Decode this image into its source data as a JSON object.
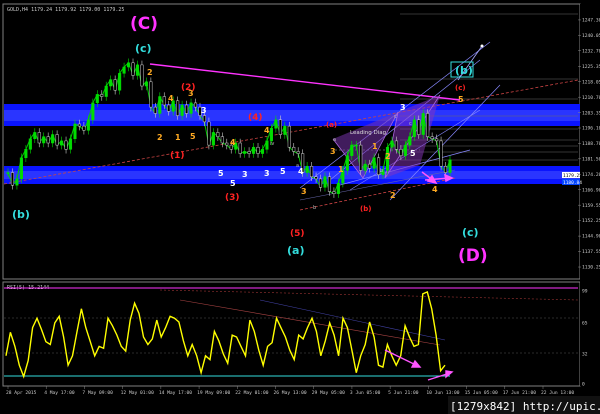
{
  "window": {
    "main_title": "GOLD,H4  1179.24 1179.92 1179.00 1179.25",
    "indicator_title": "RSI(5) 15.2144",
    "watermark": "[1279x842] http://upic.me/"
  },
  "colors": {
    "background": "#000000",
    "candle_up": "#00dd00",
    "zone_blue": "#0000ff",
    "rsi_line": "#ffff00",
    "magenta": "#ff33ff",
    "cyan_label": "#33dddd",
    "orange_label": "#ffaa22",
    "red_label": "#ff2222"
  },
  "chart_data": [
    {
      "type": "line",
      "name": "price",
      "x": [
        "28 Apr 2015",
        "4 May 17:00",
        "7 May 09:00",
        "12 May 01:00",
        "14 May 17:00",
        "19 May 09:00",
        "22 May 01:00",
        "26 May 13:00",
        "29 May 05:00",
        "3 Jun 05:00",
        "5 Jun 21:00",
        "10 Jun 13:00",
        "15 Jun 05:00",
        "17 Jun 21:00",
        "22 Jun 13:00"
      ],
      "y_ticks": [
        "1247.30",
        "1240.05",
        "1232.70",
        "1225.35",
        "1218.05",
        "1210.70",
        "1203.35",
        "1196.10",
        "1188.70",
        "1181.50",
        "1174.20",
        "1166.90",
        "1159.55",
        "1152.25",
        "1144.90",
        "1137.55",
        "1130.25"
      ],
      "ylim": [
        1126,
        1252
      ],
      "series": [
        {
          "values": [
            1175,
            1169,
            1172,
            1182,
            1186,
            1191,
            1194,
            1189,
            1192,
            1189,
            1193,
            1188,
            1190,
            1186,
            1191,
            1198,
            1197,
            1195,
            1200,
            1208,
            1212,
            1211,
            1216,
            1219,
            1214,
            1222,
            1225,
            1227,
            1221,
            1226,
            1216,
            1218,
            1206,
            1203,
            1211,
            1207,
            1204,
            1209,
            1202,
            1207,
            1203,
            1208,
            1206,
            1202,
            1199,
            1188,
            1194,
            1192,
            1189,
            1188,
            1186,
            1189,
            1184,
            1185,
            1184,
            1187,
            1184,
            1186,
            1190,
            1196,
            1200,
            1193,
            1197,
            1187,
            1185,
            1184,
            1175,
            1178,
            1173,
            1172,
            1168,
            1173,
            1166,
            1165,
            1170,
            1176,
            1183,
            1188,
            1188,
            1176,
            1179,
            1177,
            1182,
            1174,
            1176,
            1187,
            1190,
            1186,
            1183,
            1188,
            1192,
            1200,
            1193,
            1203,
            1192,
            1191,
            1190,
            1178,
            1175,
            1181
          ]
        }
      ],
      "price_box_values": [
        "1179.25",
        "1180.84"
      ]
    },
    {
      "type": "line",
      "name": "rsi",
      "y_ticks": [
        "99",
        "65",
        "32",
        "0"
      ],
      "ylim": [
        0,
        100
      ],
      "series": [
        {
          "values": [
            30,
            55,
            40,
            20,
            8,
            25,
            60,
            70,
            58,
            45,
            42,
            65,
            72,
            50,
            20,
            30,
            55,
            80,
            60,
            45,
            30,
            40,
            38,
            70,
            62,
            52,
            40,
            35,
            68,
            86,
            75,
            50,
            42,
            48,
            68,
            50,
            60,
            72,
            70,
            66,
            46,
            30,
            42,
            30,
            12,
            30,
            26,
            56,
            46,
            32,
            22,
            52,
            50,
            40,
            30,
            68,
            56,
            36,
            20,
            40,
            44,
            70,
            60,
            50,
            36,
            26,
            52,
            48,
            60,
            70,
            56,
            30,
            46,
            65,
            52,
            30,
            70,
            60,
            36,
            12,
            30,
            42,
            66,
            50,
            20,
            18,
            42,
            30,
            20,
            30,
            62,
            50,
            40,
            42,
            96,
            98,
            80,
            52,
            14,
            20
          ]
        }
      ]
    }
  ],
  "labels": {
    "C_big": "(C)",
    "c_cyan": "(c)",
    "b_cyan": "(b)",
    "a_cyan": "(a)",
    "c_lower": "(c)",
    "D_big": "(D)",
    "b_box": "(b)",
    "c_red": "(c)",
    "one_red": "(1)",
    "two_red": "(2)",
    "three_red": "(3)",
    "four_red": "(4)",
    "five_red": "(5)",
    "a_red": "(a)",
    "b_red": "(b)",
    "leading_diag": "Leading Diag",
    "ow": [
      "2",
      "4",
      "2",
      "3",
      "5",
      "1",
      "3",
      "5",
      "4",
      "3",
      "5",
      "3",
      "4",
      "5",
      "4",
      "3",
      "1",
      "3",
      "2",
      "5",
      "4",
      "5",
      "1",
      "3",
      "2"
    ],
    "ow_small": [
      "a",
      "c",
      "b",
      "iv",
      "c",
      "b",
      "a"
    ]
  }
}
